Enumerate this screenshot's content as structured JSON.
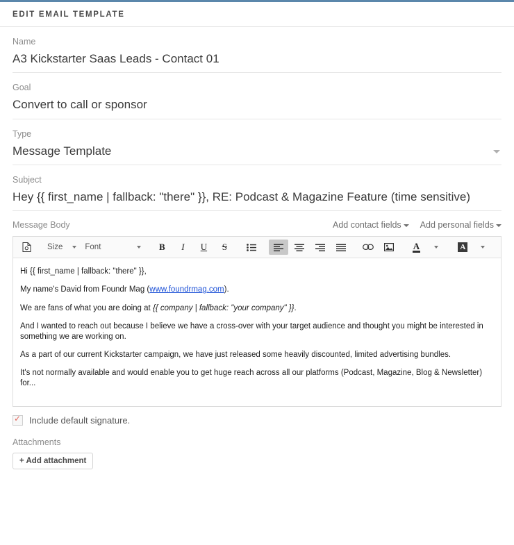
{
  "theme": {
    "accent_bar": "#5b87ab",
    "link_color": "#1a4fd6",
    "checkbox_tick": "#e2665c"
  },
  "header": {
    "title": "EDIT EMAIL TEMPLATE"
  },
  "fields": {
    "name": {
      "label": "Name",
      "value": "A3 Kickstarter Saas Leads - Contact 01"
    },
    "goal": {
      "label": "Goal",
      "value": "Convert to call or sponsor"
    },
    "type": {
      "label": "Type",
      "value": "Message Template"
    },
    "subject": {
      "label": "Subject",
      "value": "Hey {{ first_name | fallback: \"there\" }}, RE:  Podcast & Magazine Feature (time sensitive)"
    }
  },
  "message_body": {
    "label": "Message Body",
    "add_contact_fields": "Add contact fields",
    "add_personal_fields": "Add personal fields",
    "toolbar": {
      "source_icon": "source-code-icon",
      "size_label": "Size",
      "font_label": "Font",
      "bold": "B",
      "italic": "I",
      "underline": "U",
      "strikethrough": "S",
      "bullet_list": "bullet-list-icon",
      "align_left": "align-left-icon",
      "align_center": "align-center-icon",
      "align_right": "align-right-icon",
      "align_justify": "align-justify-icon",
      "link": "link-icon",
      "image": "image-icon",
      "font_color": "A",
      "highlight_color": "A"
    },
    "content": {
      "p1": "Hi {{ first_name | fallback: \"there\" }},",
      "p2_before": "My name's David from Foundr Mag (",
      "p2_link": "www.foundrmag.com",
      "p2_after": ").",
      "p3_before": "We are fans of what you are doing at ",
      "p3_merge": "{{ company | fallback: \"your company\" }}",
      "p3_after": ".",
      "p4": "And I wanted to reach out because I believe we have a cross-over with your target audience and thought you might be interested in something we are working on.",
      "p5": "As a part of our current Kickstarter campaign, we have just released some heavily discounted, limited advertising bundles.",
      "p6": "It's not normally available and would enable you to get huge reach across all our platforms (Podcast, Magazine, Blog & Newsletter) for..."
    }
  },
  "footer": {
    "signature_label": "Include default signature.",
    "signature_checked": true,
    "attachments_label": "Attachments",
    "add_attachment_label": "+ Add attachment"
  }
}
